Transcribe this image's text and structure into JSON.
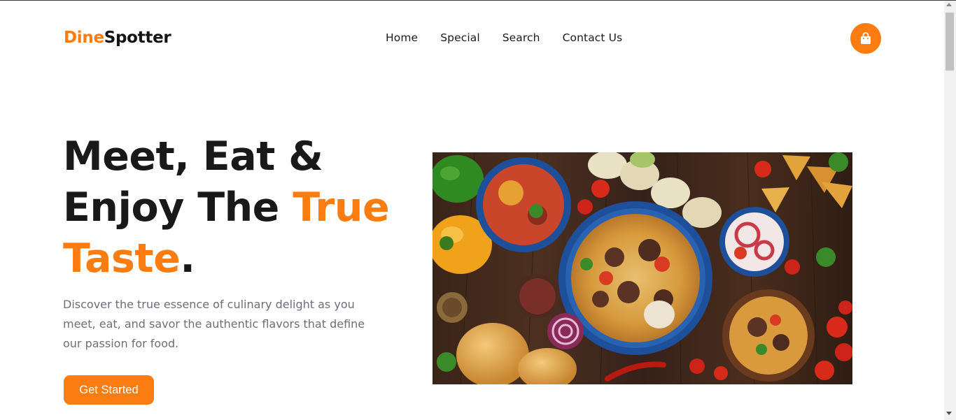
{
  "brand": {
    "part1": "Dine",
    "part2": "Spotter",
    "accent_color": "#fb7c10"
  },
  "nav": [
    {
      "label": "Home"
    },
    {
      "label": "Special"
    },
    {
      "label": "Search"
    },
    {
      "label": "Contact Us"
    }
  ],
  "cart": {
    "icon": "shopping-bag-icon"
  },
  "hero": {
    "line1": "Meet, Eat &",
    "line2_a": "Enjoy The ",
    "line2_b": "True",
    "line3_a": "Taste",
    "line3_b": ".",
    "description": "Discover the true essence of culinary delight as you meet, eat, and savor the authentic flavors that define our passion for food.",
    "cta_label": "Get Started"
  },
  "image": {
    "alt": "food spread photo"
  }
}
